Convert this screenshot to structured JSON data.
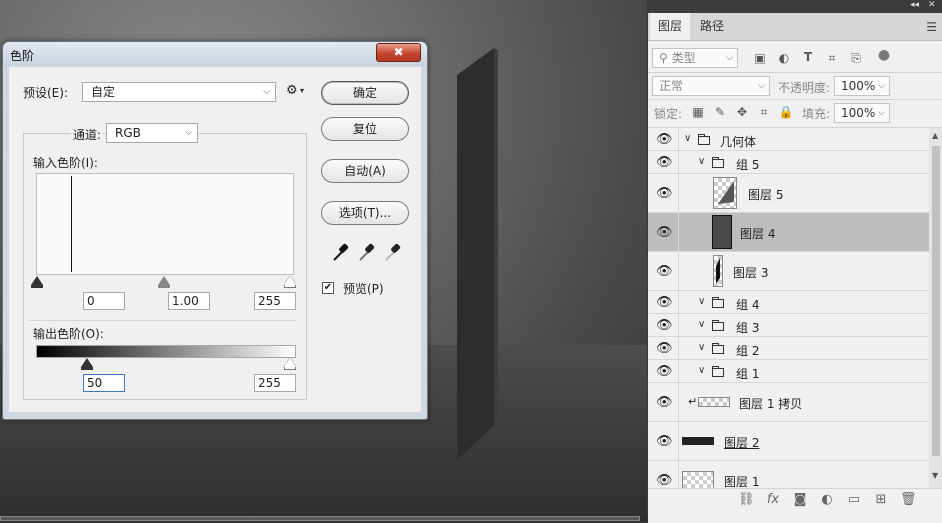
{
  "dialog": {
    "title": "色阶",
    "close_label": "✖",
    "preset_label": "预设(E):",
    "preset_value": "自定",
    "channel_label": "通道:",
    "channel_value": "RGB",
    "input_levels_label": "输入色阶(I):",
    "input_black": "0",
    "input_gamma": "1.00",
    "input_white": "255",
    "output_levels_label": "输出色阶(O):",
    "output_black": "50",
    "output_white": "255",
    "buttons": {
      "ok": "确定",
      "reset": "复位",
      "auto": "自动(A)",
      "options": "选项(T)..."
    },
    "preview_label": "预览(P)",
    "preview_checked": true,
    "gear_icon": "⚙"
  },
  "panel": {
    "tabs": [
      "图层",
      "路径"
    ],
    "filter_label": "类型",
    "blend_mode": "正常",
    "opacity_label": "不透明度:",
    "opacity_value": "100%",
    "lock_label": "锁定:",
    "fill_label": "填充:",
    "fill_value": "100%",
    "layers": [
      {
        "name": "几何体",
        "type": "group"
      },
      {
        "name": "组 5",
        "type": "group"
      },
      {
        "name": "图层 5",
        "type": "layer"
      },
      {
        "name": "图层 4",
        "type": "layer",
        "selected": true
      },
      {
        "name": "图层 3",
        "type": "layer"
      },
      {
        "name": "组 4",
        "type": "group"
      },
      {
        "name": "组 3",
        "type": "group"
      },
      {
        "name": "组 2",
        "type": "group"
      },
      {
        "name": "组 1",
        "type": "group"
      },
      {
        "name": "图层 1 拷贝",
        "type": "layer"
      },
      {
        "name": "图层 2",
        "type": "layer"
      },
      {
        "name": "图层 1",
        "type": "layer"
      }
    ]
  },
  "colors": {
    "selected_row": "#bdbdbd",
    "close_button": "#c7452f",
    "focus_border": "#3b78c4"
  }
}
